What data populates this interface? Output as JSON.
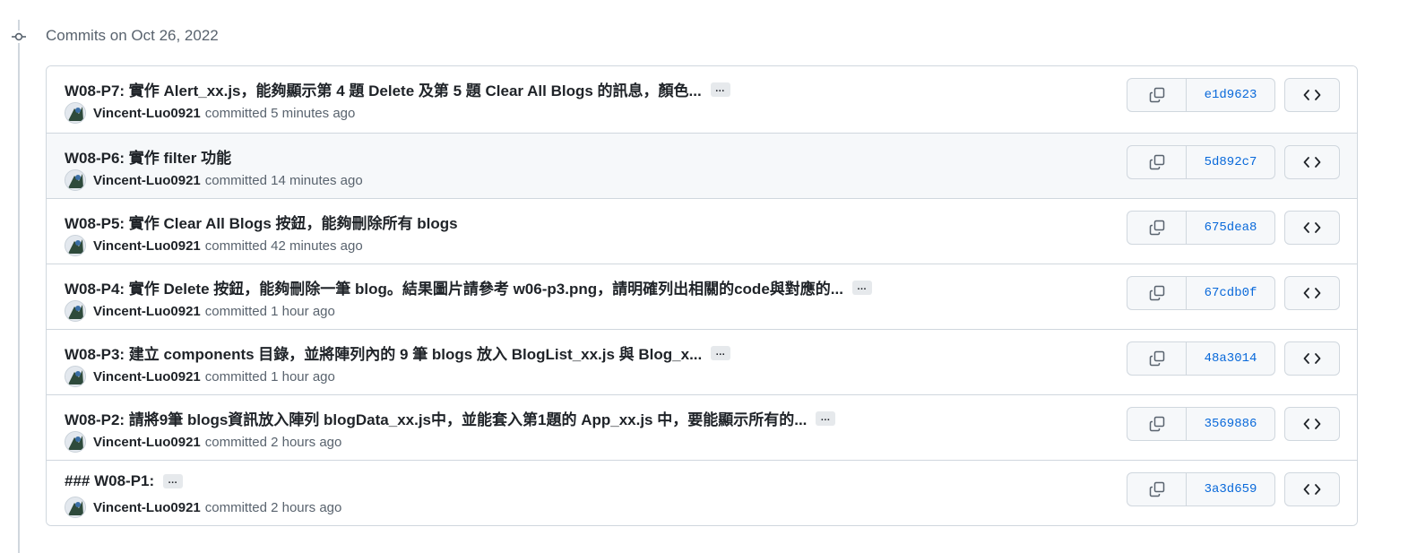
{
  "group": {
    "title": "Commits on Oct 26, 2022"
  },
  "commits": [
    {
      "message": "W08-P7: 實作 Alert_xx.js，能夠顯示第 4 題 Delete 及第 5 題 Clear All Blogs 的訊息，顏色...",
      "expand_label": "…",
      "author": "Vincent-Luo0921",
      "time_text": "committed 5 minutes ago",
      "sha": "e1d9623"
    },
    {
      "message": "W08-P6: 實作 filter 功能",
      "expand_label": "",
      "author": "Vincent-Luo0921",
      "time_text": "committed 14 minutes ago",
      "sha": "5d892c7"
    },
    {
      "message": "W08-P5: 實作 Clear All Blogs 按鈕，能夠刪除所有 blogs",
      "expand_label": "",
      "author": "Vincent-Luo0921",
      "time_text": "committed 42 minutes ago",
      "sha": "675dea8"
    },
    {
      "message": "W08-P4: 實作 Delete 按鈕，能夠刪除一筆 blog。結果圖片請參考 w06-p3.png，請明確列出相關的code與對應的...",
      "expand_label": "…",
      "author": "Vincent-Luo0921",
      "time_text": "committed 1 hour ago",
      "sha": "67cdb0f"
    },
    {
      "message": "W08-P3: 建立 components 目錄，並將陣列內的 9 筆 blogs 放入 BlogList_xx.js 與 Blog_x...",
      "expand_label": "…",
      "author": "Vincent-Luo0921",
      "time_text": "committed 1 hour ago",
      "sha": "48a3014"
    },
    {
      "message": "W08-P2: 請將9筆 blogs資訊放入陣列 blogData_xx.js中，並能套入第1題的 App_xx.js 中，要能顯示所有的...",
      "expand_label": "…",
      "author": "Vincent-Luo0921",
      "time_text": "committed 2 hours ago",
      "sha": "3569886"
    },
    {
      "message": "### W08-P1:",
      "expand_label": "…",
      "author": "Vincent-Luo0921",
      "time_text": "committed 2 hours ago",
      "sha": "3a3d659"
    }
  ],
  "icons": {
    "timeline": "git-commit-icon",
    "copy": "copy-icon",
    "browse": "code-brackets-icon"
  },
  "colors": {
    "link": "#0969da",
    "muted": "#59636e",
    "border": "#d0d7de",
    "hover_row": "#f6f8fa"
  }
}
